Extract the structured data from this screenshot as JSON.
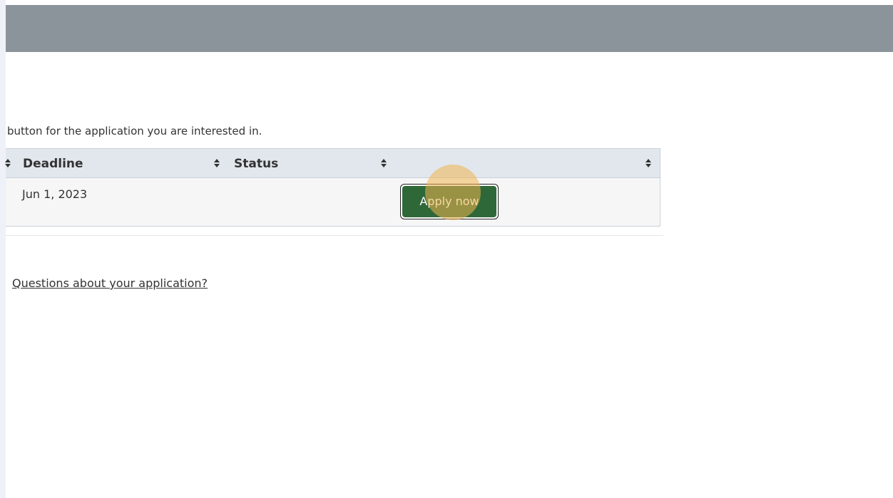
{
  "instruction_text": "button for the application you are interested in.",
  "table": {
    "columns": [
      {
        "label": ""
      },
      {
        "label": "Deadline"
      },
      {
        "label": "Status"
      },
      {
        "label": ""
      }
    ],
    "rows": [
      {
        "deadline": "Jun 1, 2023",
        "status": "",
        "action_label": "Apply now"
      }
    ]
  },
  "questions_link": "Questions about your application?",
  "colors": {
    "top_band": "#8c949b",
    "header_bg": "#e1e7ed",
    "row_bg": "#f6f6f6",
    "apply_button": "#2f6838",
    "click_highlight": "#f0b450"
  },
  "icons": {
    "sort": "sort-icon"
  }
}
